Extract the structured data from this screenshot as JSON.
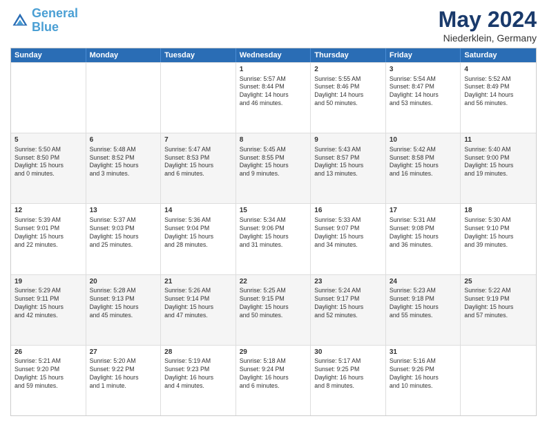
{
  "header": {
    "logo_line1": "General",
    "logo_line2": "Blue",
    "month": "May 2024",
    "location": "Niederklein, Germany"
  },
  "weekdays": [
    "Sunday",
    "Monday",
    "Tuesday",
    "Wednesday",
    "Thursday",
    "Friday",
    "Saturday"
  ],
  "rows": [
    [
      {
        "day": "",
        "text": ""
      },
      {
        "day": "",
        "text": ""
      },
      {
        "day": "",
        "text": ""
      },
      {
        "day": "1",
        "text": "Sunrise: 5:57 AM\nSunset: 8:44 PM\nDaylight: 14 hours\nand 46 minutes."
      },
      {
        "day": "2",
        "text": "Sunrise: 5:55 AM\nSunset: 8:46 PM\nDaylight: 14 hours\nand 50 minutes."
      },
      {
        "day": "3",
        "text": "Sunrise: 5:54 AM\nSunset: 8:47 PM\nDaylight: 14 hours\nand 53 minutes."
      },
      {
        "day": "4",
        "text": "Sunrise: 5:52 AM\nSunset: 8:49 PM\nDaylight: 14 hours\nand 56 minutes."
      }
    ],
    [
      {
        "day": "5",
        "text": "Sunrise: 5:50 AM\nSunset: 8:50 PM\nDaylight: 15 hours\nand 0 minutes."
      },
      {
        "day": "6",
        "text": "Sunrise: 5:48 AM\nSunset: 8:52 PM\nDaylight: 15 hours\nand 3 minutes."
      },
      {
        "day": "7",
        "text": "Sunrise: 5:47 AM\nSunset: 8:53 PM\nDaylight: 15 hours\nand 6 minutes."
      },
      {
        "day": "8",
        "text": "Sunrise: 5:45 AM\nSunset: 8:55 PM\nDaylight: 15 hours\nand 9 minutes."
      },
      {
        "day": "9",
        "text": "Sunrise: 5:43 AM\nSunset: 8:57 PM\nDaylight: 15 hours\nand 13 minutes."
      },
      {
        "day": "10",
        "text": "Sunrise: 5:42 AM\nSunset: 8:58 PM\nDaylight: 15 hours\nand 16 minutes."
      },
      {
        "day": "11",
        "text": "Sunrise: 5:40 AM\nSunset: 9:00 PM\nDaylight: 15 hours\nand 19 minutes."
      }
    ],
    [
      {
        "day": "12",
        "text": "Sunrise: 5:39 AM\nSunset: 9:01 PM\nDaylight: 15 hours\nand 22 minutes."
      },
      {
        "day": "13",
        "text": "Sunrise: 5:37 AM\nSunset: 9:03 PM\nDaylight: 15 hours\nand 25 minutes."
      },
      {
        "day": "14",
        "text": "Sunrise: 5:36 AM\nSunset: 9:04 PM\nDaylight: 15 hours\nand 28 minutes."
      },
      {
        "day": "15",
        "text": "Sunrise: 5:34 AM\nSunset: 9:06 PM\nDaylight: 15 hours\nand 31 minutes."
      },
      {
        "day": "16",
        "text": "Sunrise: 5:33 AM\nSunset: 9:07 PM\nDaylight: 15 hours\nand 34 minutes."
      },
      {
        "day": "17",
        "text": "Sunrise: 5:31 AM\nSunset: 9:08 PM\nDaylight: 15 hours\nand 36 minutes."
      },
      {
        "day": "18",
        "text": "Sunrise: 5:30 AM\nSunset: 9:10 PM\nDaylight: 15 hours\nand 39 minutes."
      }
    ],
    [
      {
        "day": "19",
        "text": "Sunrise: 5:29 AM\nSunset: 9:11 PM\nDaylight: 15 hours\nand 42 minutes."
      },
      {
        "day": "20",
        "text": "Sunrise: 5:28 AM\nSunset: 9:13 PM\nDaylight: 15 hours\nand 45 minutes."
      },
      {
        "day": "21",
        "text": "Sunrise: 5:26 AM\nSunset: 9:14 PM\nDaylight: 15 hours\nand 47 minutes."
      },
      {
        "day": "22",
        "text": "Sunrise: 5:25 AM\nSunset: 9:15 PM\nDaylight: 15 hours\nand 50 minutes."
      },
      {
        "day": "23",
        "text": "Sunrise: 5:24 AM\nSunset: 9:17 PM\nDaylight: 15 hours\nand 52 minutes."
      },
      {
        "day": "24",
        "text": "Sunrise: 5:23 AM\nSunset: 9:18 PM\nDaylight: 15 hours\nand 55 minutes."
      },
      {
        "day": "25",
        "text": "Sunrise: 5:22 AM\nSunset: 9:19 PM\nDaylight: 15 hours\nand 57 minutes."
      }
    ],
    [
      {
        "day": "26",
        "text": "Sunrise: 5:21 AM\nSunset: 9:20 PM\nDaylight: 15 hours\nand 59 minutes."
      },
      {
        "day": "27",
        "text": "Sunrise: 5:20 AM\nSunset: 9:22 PM\nDaylight: 16 hours\nand 1 minute."
      },
      {
        "day": "28",
        "text": "Sunrise: 5:19 AM\nSunset: 9:23 PM\nDaylight: 16 hours\nand 4 minutes."
      },
      {
        "day": "29",
        "text": "Sunrise: 5:18 AM\nSunset: 9:24 PM\nDaylight: 16 hours\nand 6 minutes."
      },
      {
        "day": "30",
        "text": "Sunrise: 5:17 AM\nSunset: 9:25 PM\nDaylight: 16 hours\nand 8 minutes."
      },
      {
        "day": "31",
        "text": "Sunrise: 5:16 AM\nSunset: 9:26 PM\nDaylight: 16 hours\nand 10 minutes."
      },
      {
        "day": "",
        "text": ""
      }
    ]
  ]
}
